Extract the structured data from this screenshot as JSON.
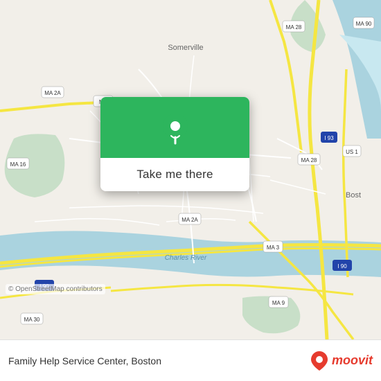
{
  "map": {
    "attribution": "© OpenStreetMap contributors",
    "center_label": "Boston, MA",
    "accent_color": "#2db55d"
  },
  "popup": {
    "button_label": "Take me there"
  },
  "bottom_bar": {
    "location_text": "Family Help Service Center, Boston",
    "moovit_label": "moovit"
  },
  "roads": {
    "highway_color": "#f5e642",
    "major_road_color": "#ffffff",
    "minor_road_color": "#e8ddd0",
    "water_color": "#aad3df",
    "park_color": "#c8dfc8",
    "land_color": "#f2efe9"
  }
}
